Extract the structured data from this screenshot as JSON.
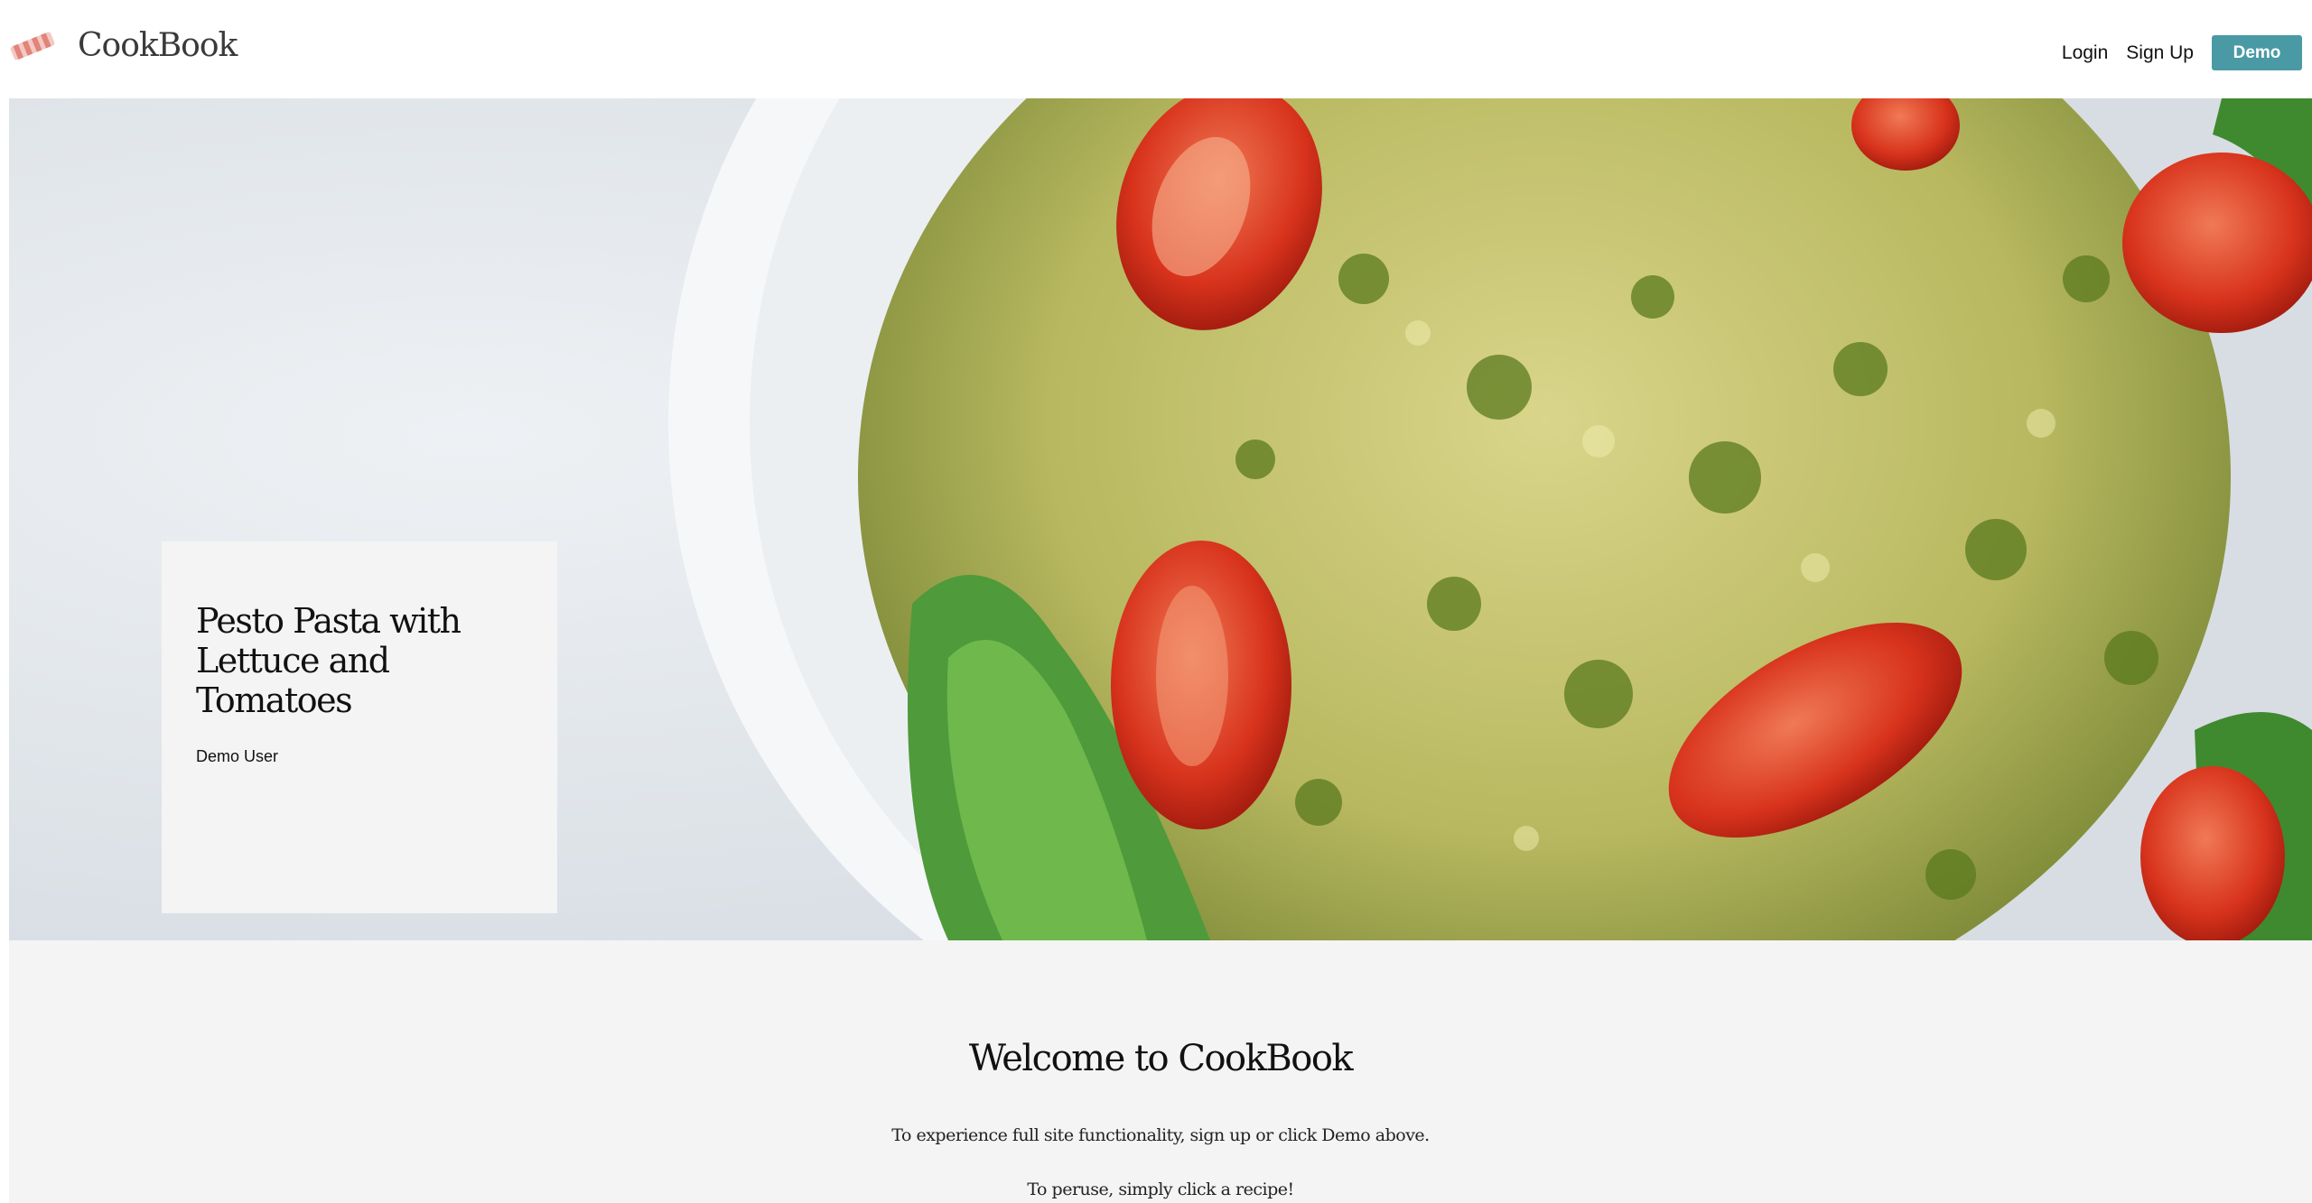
{
  "header": {
    "brand_name": "CookBook",
    "logo_icon": "bacon-strip-logo-icon",
    "nav": {
      "login_label": "Login",
      "signup_label": "Sign Up",
      "demo_label": "Demo"
    },
    "demo_button_color": "#4a9aa5"
  },
  "hero": {
    "image_subject": "pesto-pasta-photo",
    "recipe": {
      "title": "Pesto Pasta with Lettuce and Tomatoes",
      "author": "Demo User"
    }
  },
  "welcome": {
    "title": "Welcome to CookBook",
    "line1": "To experience full site functionality, sign up or click Demo above.",
    "line2": "To peruse, simply click a recipe!"
  },
  "colors": {
    "page_background": "#ffffff",
    "panel_background": "#f4f4f4",
    "text": "#111111"
  }
}
